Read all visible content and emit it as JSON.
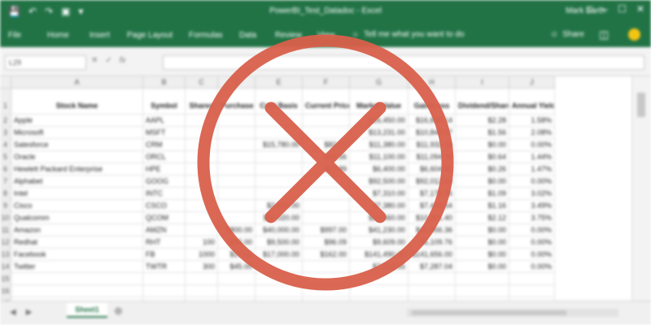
{
  "app": {
    "title": "PowerBI_Test_Datadoc - Excel",
    "user": "Mark Barth"
  },
  "ribbon": {
    "tabs": [
      "File",
      "Home",
      "Insert",
      "Page Layout",
      "Formulas",
      "Data",
      "Review",
      "View"
    ],
    "tell_me": "Tell me what you want to do",
    "share": "Share"
  },
  "formula_bar": {
    "name_box": "L29",
    "value": ""
  },
  "columns": [
    "A",
    "B",
    "C",
    "D",
    "E",
    "F",
    "G",
    "H",
    "I",
    "J"
  ],
  "headers": [
    "Stock Name",
    "Symbol",
    "Shares",
    "Purchase Price",
    "Cost Basis",
    "Current Price",
    "Market Value",
    "Gain/Loss",
    "Dividend/Share",
    "Annual Yield"
  ],
  "rows": [
    [
      "Apple",
      "AAPL",
      "",
      "",
      "",
      "",
      "$16,450.00",
      "$16,899.14",
      "$2.28",
      "1.58%"
    ],
    [
      "Microsoft",
      "MSFT",
      "",
      "",
      "",
      "",
      "$13,231.00",
      "$10,848.57",
      "$1.56",
      "2.08%"
    ],
    [
      "Salesforce",
      "CRM",
      "",
      "",
      "$15,780.00",
      "$82.07",
      "$11,380.00",
      "$11,932.56",
      "$0.00",
      "0.00%"
    ],
    [
      "Oracle",
      "ORCL",
      "",
      "",
      "",
      "$46.56",
      "$11,100.00",
      "$11,094.35",
      "$0.64",
      "1.44%"
    ],
    [
      "Hewlett Packard Enterprise",
      "HPE",
      "",
      "",
      "",
      "$17.89",
      "$6,400.00",
      "$6,604.82",
      "$0.26",
      "1.47%"
    ],
    [
      "Alphabet",
      "GOOG",
      "",
      "",
      "",
      "",
      "$92,500.00",
      "$92,012.04",
      "$0.00",
      "0.00%"
    ],
    [
      "Intel",
      "INTC",
      "",
      "",
      "",
      "",
      "$7,310.00",
      "$7,178.96",
      "$1.09",
      "3.02%"
    ],
    [
      "Cisco",
      "CSCO",
      "",
      "",
      "$2,000.00",
      "",
      "$7,380.00",
      "$7,445.54",
      "$1.16",
      "3.49%"
    ],
    [
      "Qualcomm",
      "QCOM",
      "",
      "",
      "$11,020.00",
      "",
      "$21,460.00",
      "$10,391.40",
      "$2.12",
      "3.75%"
    ],
    [
      "Amazon",
      "AMZN",
      "",
      "$800.00",
      "$40,000.00",
      "$997.00",
      "$41,230.00",
      "$41,956.36",
      "$0.00",
      "0.00%"
    ],
    [
      "Redhat",
      "RHT",
      "100",
      "$95.00",
      "$9,500.00",
      "$96.09",
      "$9,609.00",
      "$6,109.76",
      "$0.00",
      "0.00%"
    ],
    [
      "Facebook",
      "FB",
      "1000",
      "$17.00",
      "$17,000.00",
      "$162.00",
      "$141,490.00",
      "$141,656.00",
      "$0.00",
      "0.00%"
    ],
    [
      "Twitter",
      "TWTR",
      "300",
      "$45.00",
      "",
      "",
      "$7,902.55",
      "$7,287.04",
      "$0.00",
      "0.00%"
    ]
  ],
  "sheet_tab": "Sheet1",
  "colors": {
    "excel_green": "#217346",
    "overlay_red": "#d9604b"
  },
  "overlay": {
    "icon": "circle-x-icon"
  }
}
